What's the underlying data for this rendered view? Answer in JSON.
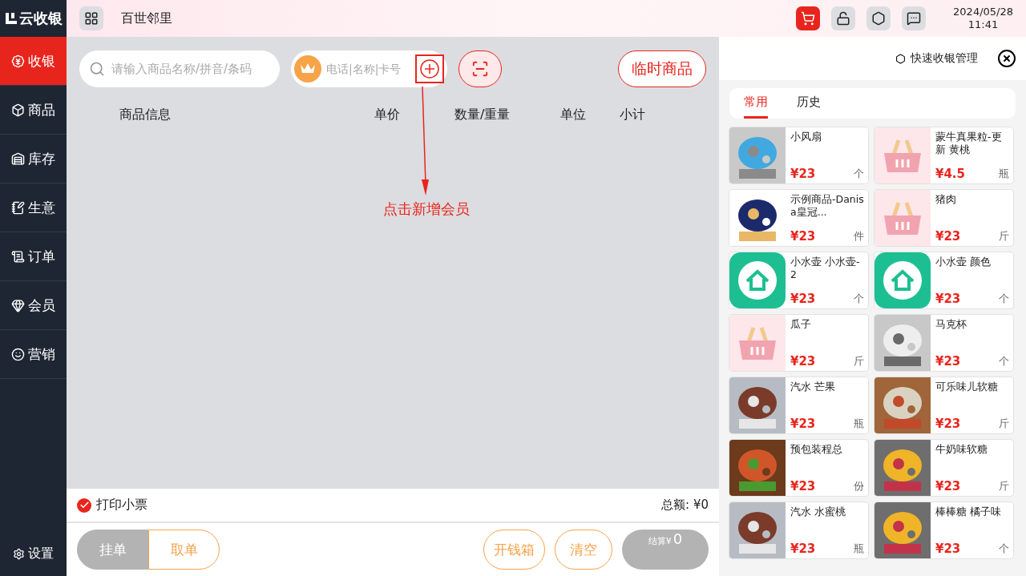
{
  "brand": "云收银",
  "store": "百世邻里",
  "top_icons": [
    {
      "kind": "cart",
      "selected": true
    },
    {
      "kind": "lock",
      "selected": false
    },
    {
      "kind": "hex",
      "selected": false
    },
    {
      "kind": "chat",
      "selected": false
    }
  ],
  "datetime": {
    "date": "2024/05/28",
    "time": "11:41"
  },
  "sidebar": {
    "items": [
      {
        "kind": "cashier",
        "label": "收银",
        "selected": true
      },
      {
        "kind": "goods",
        "label": "商品",
        "selected": false
      },
      {
        "kind": "stock",
        "label": "库存",
        "selected": false
      },
      {
        "kind": "business",
        "label": "生意",
        "selected": false
      },
      {
        "kind": "order",
        "label": "订单",
        "selected": false
      },
      {
        "kind": "member",
        "label": "会员",
        "selected": false
      },
      {
        "kind": "marketing",
        "label": "营销",
        "selected": false
      }
    ],
    "settings": "设置"
  },
  "search": {
    "placeholder": "请输入商品名称/拼音/条码"
  },
  "member_field": {
    "placeholder": "电话|名称|卡号"
  },
  "temp_goods_button": "临时商品",
  "table": {
    "columns": [
      "商品信息",
      "单价",
      "数量/重量",
      "单位",
      "小计"
    ]
  },
  "annotation": {
    "text": "点击新增会员"
  },
  "print_receipt": {
    "label": "打印小票",
    "checked": true
  },
  "total": "总额: ¥0",
  "buttons": {
    "hold": "挂单",
    "retrieve": "取单",
    "cash_drawer": "开钱箱",
    "clear": "清空",
    "checkout_label": "结算¥",
    "checkout_amount": "0"
  },
  "quick_panel": {
    "manage": "快速收银管理",
    "tabs": [
      {
        "label": "常用",
        "selected": true
      },
      {
        "label": "历史",
        "selected": false
      }
    ],
    "products": [
      {
        "name": "小风扇",
        "price": "¥23",
        "unit": "个",
        "kind": "picture"
      },
      {
        "name": "蒙牛真果粒-更新 黄桃",
        "price": "¥4.5",
        "unit": "瓶",
        "kind": "basket"
      },
      {
        "name": "示例商品-Danisa皇冠...",
        "price": "¥23",
        "unit": "件",
        "kind": "picture"
      },
      {
        "name": "猪肉",
        "price": "¥23",
        "unit": "斤",
        "kind": "basket"
      },
      {
        "name": "小水壶 小水壶-2",
        "price": "¥23",
        "unit": "个",
        "kind": "app"
      },
      {
        "name": "小水壶 颜色",
        "price": "¥23",
        "unit": "个",
        "kind": "app"
      },
      {
        "name": "瓜子",
        "price": "¥23",
        "unit": "斤",
        "kind": "basket"
      },
      {
        "name": "马克杯",
        "price": "¥23",
        "unit": "个",
        "kind": "picture"
      },
      {
        "name": "汽水 芒果",
        "price": "¥23",
        "unit": "瓶",
        "kind": "picture"
      },
      {
        "name": "可乐味儿软糖",
        "price": "¥23",
        "unit": "斤",
        "kind": "picture"
      },
      {
        "name": "预包装程总",
        "price": "¥23",
        "unit": "份",
        "kind": "picture"
      },
      {
        "name": "牛奶味软糖",
        "price": "¥23",
        "unit": "斤",
        "kind": "picture"
      },
      {
        "name": "汽水 水蜜桃",
        "price": "¥23",
        "unit": "瓶",
        "kind": "picture"
      },
      {
        "name": "棒棒糖 橘子味",
        "price": "¥23",
        "unit": "个",
        "kind": "picture"
      }
    ]
  }
}
